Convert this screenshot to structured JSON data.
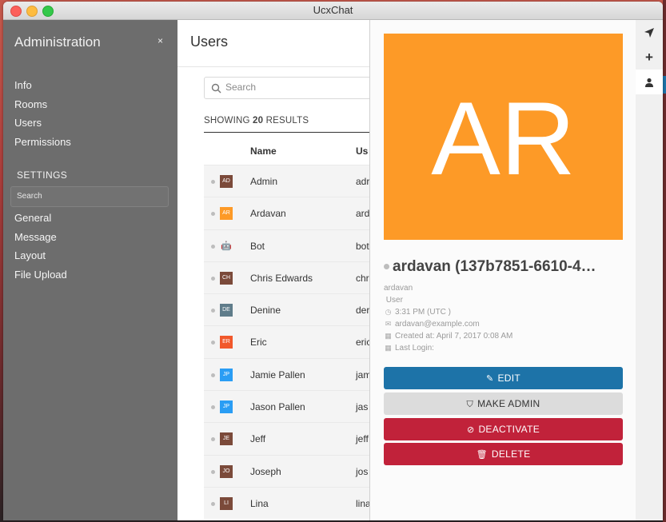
{
  "window": {
    "title": "UcxChat"
  },
  "sidebar": {
    "title": "Administration",
    "close_label": "×",
    "nav_items": [
      "Info",
      "Rooms",
      "Users",
      "Permissions"
    ],
    "settings_title": "SETTINGS",
    "search_placeholder": "Search",
    "settings_items": [
      "General",
      "Message",
      "Layout",
      "File Upload"
    ]
  },
  "main": {
    "title": "Users",
    "search_placeholder": "Search",
    "showing_prefix": "SHOWING",
    "result_count": "20",
    "showing_suffix": "RESULTS",
    "columns": [
      "Name",
      "Us"
    ],
    "rows": [
      {
        "initials": "AD",
        "name": "Admin",
        "username": "adr",
        "color": "#7b4a3a"
      },
      {
        "initials": "AR",
        "name": "Ardavan",
        "username": "ard",
        "color": "#fd9a27"
      },
      {
        "initials": "",
        "name": "Bot",
        "username": "bot",
        "color": "#f4f4f4"
      },
      {
        "initials": "CH",
        "name": "Chris Edwards",
        "username": "chr",
        "color": "#7b4a3a"
      },
      {
        "initials": "DE",
        "name": "Denine",
        "username": "der",
        "color": "#5f7c8a"
      },
      {
        "initials": "ER",
        "name": "Eric",
        "username": "eric",
        "color": "#f1582b"
      },
      {
        "initials": "JP",
        "name": "Jamie Pallen",
        "username": "jam",
        "color": "#2a9df4"
      },
      {
        "initials": "JP",
        "name": "Jason Pallen",
        "username": "jas",
        "color": "#2a9df4"
      },
      {
        "initials": "JE",
        "name": "Jeff",
        "username": "jeff",
        "color": "#7b4a3a"
      },
      {
        "initials": "JO",
        "name": "Joseph",
        "username": "jos",
        "color": "#7b4a3a"
      },
      {
        "initials": "LI",
        "name": "Lina",
        "username": "lina",
        "color": "#7b4a3a"
      }
    ]
  },
  "panel": {
    "avatar_initials": "AR",
    "avatar_color": "#fd9a27",
    "display_name": "ardavan (137b7851-6610-4…",
    "username": "ardavan",
    "role": "User",
    "time": "3:31 PM (UTC )",
    "email": "ardavan@example.com",
    "created": "Created at: April 7, 2017 0:08 AM",
    "last_login": "Last Login:",
    "buttons": {
      "edit": "EDIT",
      "make_admin": "MAKE ADMIN",
      "deactivate": "DEACTIVATE",
      "delete": "DELETE"
    }
  },
  "rail": {
    "icons": [
      "send-icon",
      "plus-icon",
      "user-icon"
    ]
  },
  "colors": {
    "primary": "#1d73a8",
    "danger": "#c1223a",
    "sidebar": "#6d6d6d",
    "avatar_orange": "#fd9a27"
  }
}
